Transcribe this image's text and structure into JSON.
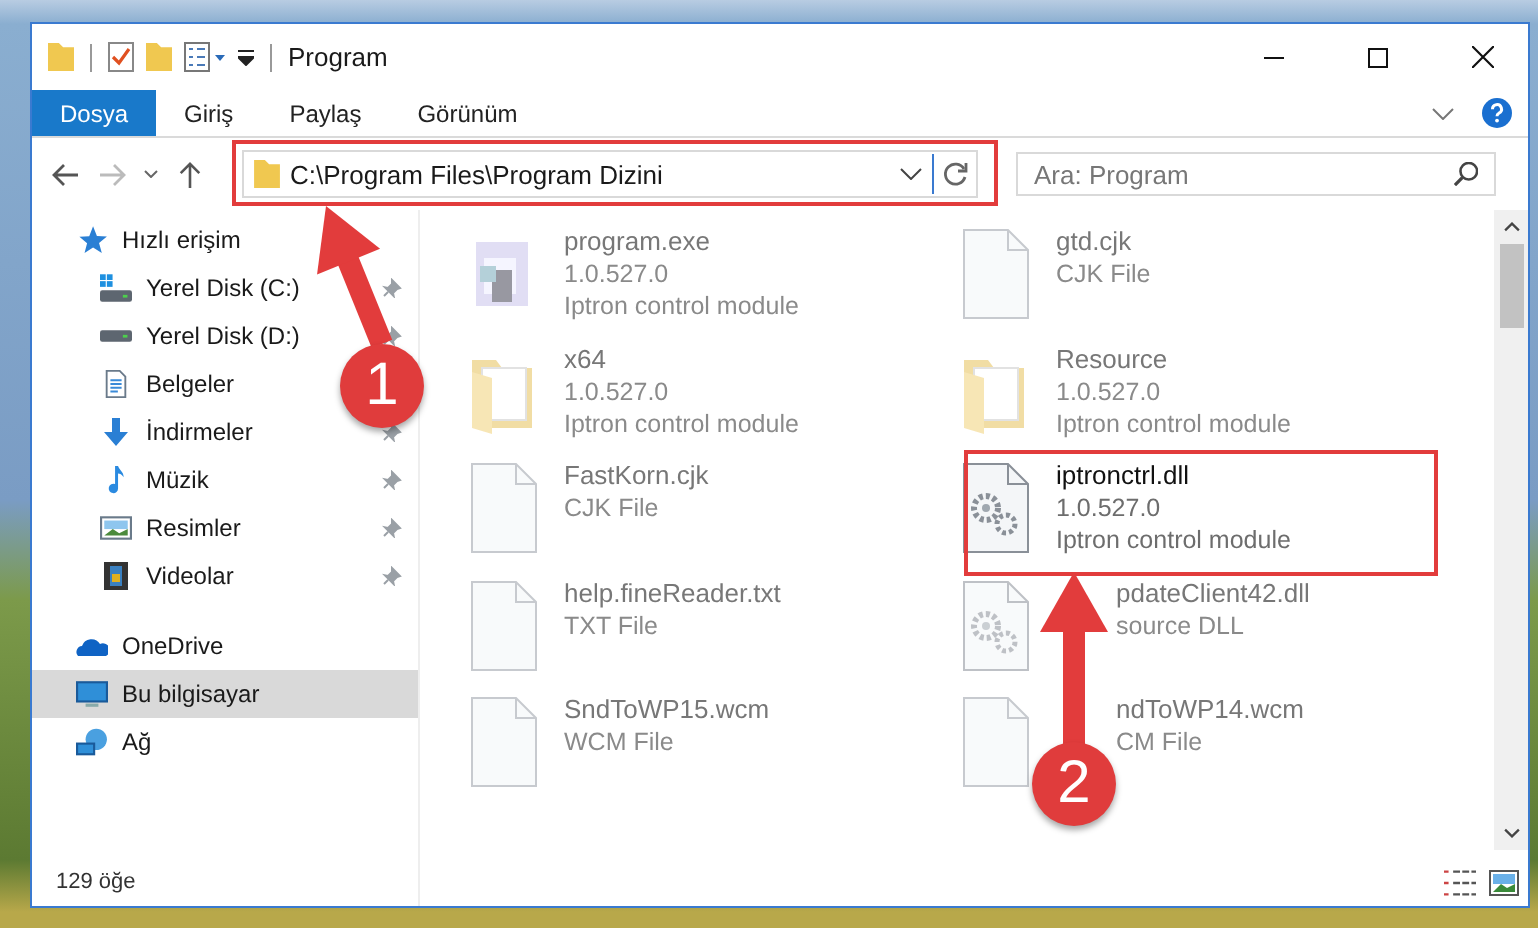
{
  "window": {
    "title": "Program"
  },
  "ribbon_tabs": [
    {
      "label": "Dosya",
      "selected": true
    },
    {
      "label": "Giriş",
      "selected": false
    },
    {
      "label": "Paylaş",
      "selected": false
    },
    {
      "label": "Görünüm",
      "selected": false
    }
  ],
  "address": {
    "path": "C:\\Program Files\\Program Dizini"
  },
  "search": {
    "placeholder": "Ara: Program"
  },
  "sidebar": {
    "items": [
      {
        "label": "Hızlı erişim",
        "kind": "star",
        "selected": false,
        "children": [
          {
            "label": "Yerel Disk (C:)",
            "kind": "drive-c",
            "pinned": true,
            "selected": false
          },
          {
            "label": "Yerel Disk (D:)",
            "kind": "drive",
            "pinned": true,
            "selected": false
          },
          {
            "label": "Belgeler",
            "kind": "docs",
            "selected": false
          },
          {
            "label": "İndirmeler",
            "kind": "download",
            "pinned": true,
            "selected": false
          },
          {
            "label": "Müzik",
            "kind": "music",
            "pinned": true,
            "selected": false
          },
          {
            "label": "Resimler",
            "kind": "pictures",
            "pinned": true,
            "selected": false
          },
          {
            "label": "Videolar",
            "kind": "video",
            "pinned": true,
            "selected": false
          }
        ]
      },
      {
        "label": "OneDrive",
        "kind": "cloud",
        "selected": false
      },
      {
        "label": "Bu bilgisayar",
        "kind": "pc",
        "selected": true
      },
      {
        "label": "Ağ",
        "kind": "network",
        "selected": false
      }
    ]
  },
  "files": [
    {
      "name": "program.exe",
      "line_2": "1.0.527.0",
      "line_3": "Iptron control module",
      "kind": "exe",
      "highlighted": false
    },
    {
      "name": "gtd.cjk",
      "line_2": "CJK File",
      "kind": "file",
      "highlighted": false
    },
    {
      "name": "x64",
      "line_2": "1.0.527.0",
      "line_3": "Iptron control module",
      "kind": "folder",
      "highlighted": false
    },
    {
      "name": "Resource",
      "line_2": "1.0.527.0",
      "line_3": "Iptron control module",
      "kind": "folder",
      "highlighted": false
    },
    {
      "name": "FastKorn.cjk",
      "line_2": "CJK File",
      "kind": "file",
      "highlighted": false
    },
    {
      "name": "iptronctrl.dll",
      "line_2": "1.0.527.0",
      "line_3": "Iptron control module",
      "kind": "dll",
      "highlighted": true
    },
    {
      "name": "help.fineReader.txt",
      "line_2": "TXT File",
      "kind": "file",
      "highlighted": false
    },
    {
      "name": "pdateClient42.dll",
      "line_2": "source DLL",
      "kind": "dll",
      "highlighted": false,
      "covered": true
    },
    {
      "name": "SndToWP15.wcm",
      "line_2": "WCM File",
      "kind": "file",
      "highlighted": false
    },
    {
      "name": "ndToWP14.wcm",
      "line_2": "CM File",
      "kind": "file",
      "highlighted": false,
      "covered": true
    }
  ],
  "status_bar": {
    "count": "129 öğe"
  },
  "annotations": [
    {
      "number": "1"
    },
    {
      "number": "2"
    }
  ]
}
